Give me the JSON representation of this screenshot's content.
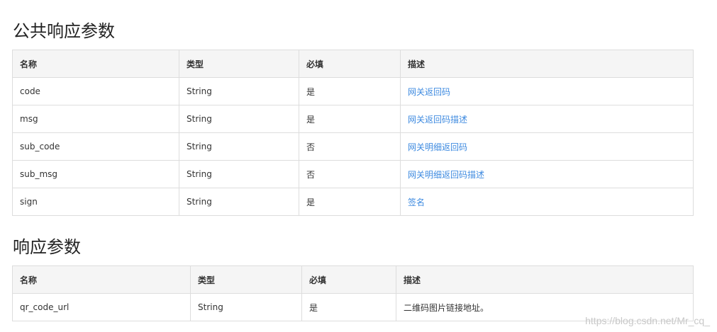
{
  "section1": {
    "title": "公共响应参数",
    "headers": [
      "名称",
      "类型",
      "必填",
      "描述"
    ],
    "rows": [
      {
        "name": "code",
        "type": "String",
        "required": "是",
        "desc": "网关返回码"
      },
      {
        "name": "msg",
        "type": "String",
        "required": "是",
        "desc": "网关返回码描述"
      },
      {
        "name": "sub_code",
        "type": "String",
        "required": "否",
        "desc": "网关明细返回码"
      },
      {
        "name": "sub_msg",
        "type": "String",
        "required": "否",
        "desc": "网关明细返回码描述"
      },
      {
        "name": "sign",
        "type": "String",
        "required": "是",
        "desc": "签名"
      }
    ]
  },
  "section2": {
    "title": "响应参数",
    "headers": [
      "名称",
      "类型",
      "必填",
      "描述"
    ],
    "rows": [
      {
        "name": "qr_code_url",
        "type": "String",
        "required": "是",
        "desc": "二维码图片链接地址。"
      }
    ]
  },
  "colors": {
    "link": "#3f8be0",
    "header_bg": "#f5f5f5",
    "border": "#dddddd"
  },
  "watermark": "https://blog.csdn.net/Mr_cq_"
}
